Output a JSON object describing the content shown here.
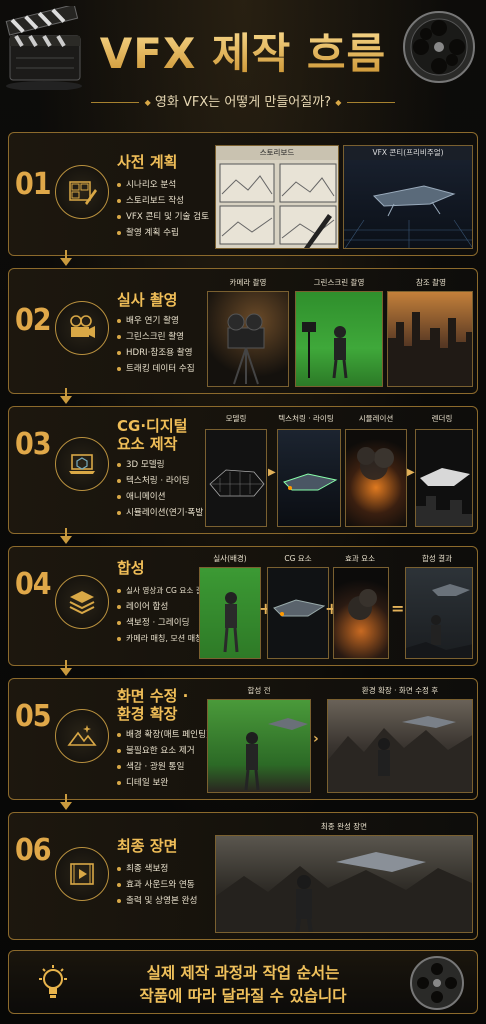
{
  "header": {
    "title": "VFX 제작 흐름",
    "subtitle": "영화 VFX는 어떻게 만들어질까?"
  },
  "sections": [
    {
      "num": "01",
      "title": "사전 계획",
      "icon": "storyboard-pencil-icon",
      "bullets": [
        "시나리오 분석",
        "스토리보드 작성",
        "VFX 콘티 및 기술 검토",
        "촬영 계획 수립"
      ],
      "captions": [
        "스토리보드",
        "VFX 콘티(프리비주얼)"
      ]
    },
    {
      "num": "02",
      "title": "실사 촬영",
      "icon": "film-camera-icon",
      "bullets": [
        "배우 연기 촬영",
        "그린스크린 촬영",
        "HDRI·참조용 촬영",
        "트래킹 데이터 수집"
      ],
      "captions": [
        "카메라 촬영",
        "그린스크린 촬영",
        "참조 촬영"
      ]
    },
    {
      "num": "03",
      "title_line1": "CG·디지털",
      "title_line2": "요소 제작",
      "icon": "laptop-3d-cube-icon",
      "bullets": [
        "3D 모델링",
        "텍스처링 · 라이팅",
        "애니메이션",
        "시뮬레이션(연기·폭발 등)"
      ],
      "captions": [
        "모델링",
        "텍스처링 · 라이팅",
        "시뮬레이션",
        "렌더링"
      ]
    },
    {
      "num": "04",
      "title": "합성",
      "icon": "layers-icon",
      "bullets": [
        "실사 영상과 CG 요소 결합",
        "레이어 합성",
        "색보정 · 그레이딩",
        "카메라 매칭, 모션 매칭"
      ],
      "captions": [
        "실사(배경)",
        "CG 요소",
        "효과 요소",
        "합성 결과"
      ],
      "operators": [
        "+",
        "+",
        "="
      ]
    },
    {
      "num": "05",
      "title_line1": "화면 수정 ·",
      "title_line2": "환경 확장",
      "icon": "mountains-sparkle-icon",
      "bullets": [
        "배경 확장(매트 페인팅)",
        "불필요한 요소 제거",
        "색감 · 광원 통일",
        "디테일 보완"
      ],
      "captions": [
        "합성 전",
        "환경 확장 · 화면 수정 후"
      ]
    },
    {
      "num": "06",
      "title": "최종 장면",
      "icon": "film-play-icon",
      "bullets": [
        "최종 색보정",
        "효과 사운드와 연동",
        "출력 및 상영본 완성"
      ],
      "captions": [
        "최종 완성 장면"
      ]
    }
  ],
  "footer": {
    "line1": "실제 제작 과정과 작업 순서는",
    "line2": "작품에 따라 달라질 수 있습니다",
    "icon": "lightbulb-icon"
  },
  "colors": {
    "accent": "#e0a849",
    "border": "#8c6a2c",
    "background": "#0b0a08",
    "green_screen": "#3fa83a"
  }
}
